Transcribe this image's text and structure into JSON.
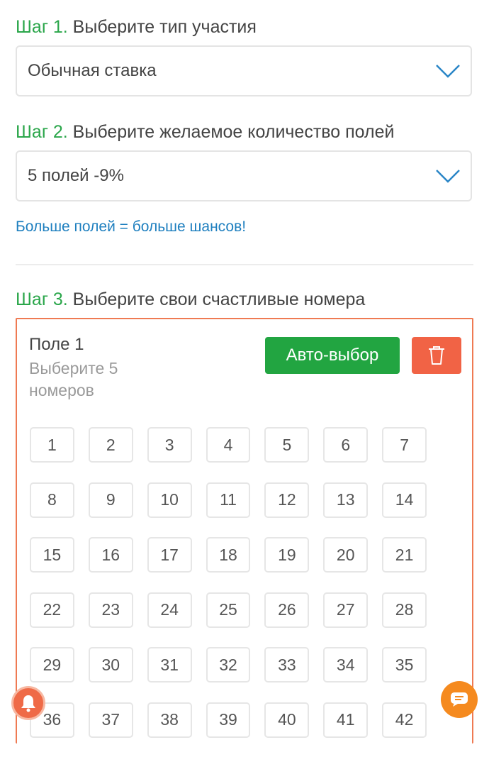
{
  "step1": {
    "num": "Шаг 1.",
    "text": " Выберите тип участия",
    "select_value": "Обычная ставка",
    "chevron_icon": "chevron-down-icon"
  },
  "step2": {
    "num": "Шаг 2.",
    "text": " Выберите желаемое количество полей",
    "select_value": "5 полей -9%",
    "chevron_icon": "chevron-down-icon"
  },
  "promo": "Больше полей = больше шансов!",
  "step3": {
    "num": "Шаг 3.",
    "text": " Выберите свои счастливые номера"
  },
  "field": {
    "title": "Поле 1",
    "hint": "Выберите 5 номеров",
    "auto_button": "Авто-выбор",
    "delete_icon": "trash-icon",
    "number_rows": [
      [
        "1",
        "2",
        "3",
        "4",
        "5",
        "6",
        "7"
      ],
      [
        "8",
        "9",
        "10",
        "11",
        "12",
        "13",
        "14"
      ],
      [
        "15",
        "16",
        "17",
        "18",
        "19",
        "20",
        "21"
      ],
      [
        "22",
        "23",
        "24",
        "25",
        "26",
        "27",
        "28"
      ],
      [
        "29",
        "30",
        "31",
        "32",
        "33",
        "34",
        "35"
      ],
      [
        "36",
        "37",
        "38",
        "39",
        "40",
        "41",
        "42"
      ]
    ]
  },
  "floating": {
    "bell_icon": "bell-icon",
    "chat_icon": "chat-icon"
  },
  "colors": {
    "step_green": "#2aa64a",
    "link_blue": "#1e7fbf",
    "auto_button_green": "#22a541",
    "delete_red": "#f16345",
    "field_border": "#ef7a53",
    "chat_orange": "#f58a1f"
  }
}
